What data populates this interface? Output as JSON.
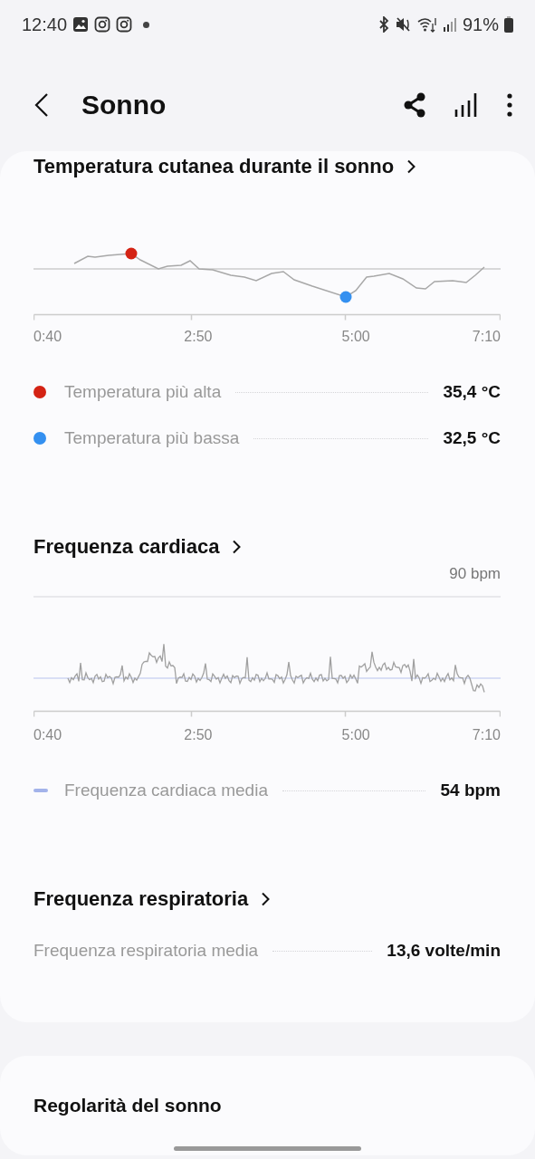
{
  "status_bar": {
    "time": "12:40",
    "battery": "91%"
  },
  "header": {
    "title": "Sonno"
  },
  "sections": [
    {
      "title": "Temperatura cutanea durante il sonno",
      "chart": {
        "kind": "temperature",
        "x_labels": [
          "0:40",
          "2:50",
          "5:00",
          "7:10"
        ]
      },
      "rows": [
        {
          "kind": "dot",
          "color": "#d42314",
          "label": "Temperatura più alta",
          "value": "35,4 °C"
        },
        {
          "kind": "dot",
          "color": "#3490f0",
          "label": "Temperatura più bassa",
          "value": "32,5 °C"
        }
      ]
    },
    {
      "title": "Frequenza cardiaca",
      "chart": {
        "kind": "heart",
        "y_label": "90 bpm",
        "x_labels": [
          "0:40",
          "2:50",
          "5:00",
          "7:10"
        ]
      },
      "rows": [
        {
          "kind": "dash",
          "color": "#a3b3ea",
          "label": "Frequenza cardiaca media",
          "value": "54 bpm"
        }
      ]
    },
    {
      "title": "Frequenza respiratoria",
      "rows": [
        {
          "kind": "plain",
          "label": "Frequenza respiratoria media",
          "value": "13,6 volte/min"
        }
      ]
    }
  ],
  "next_card": {
    "title": "Regolarità del sonno"
  }
}
